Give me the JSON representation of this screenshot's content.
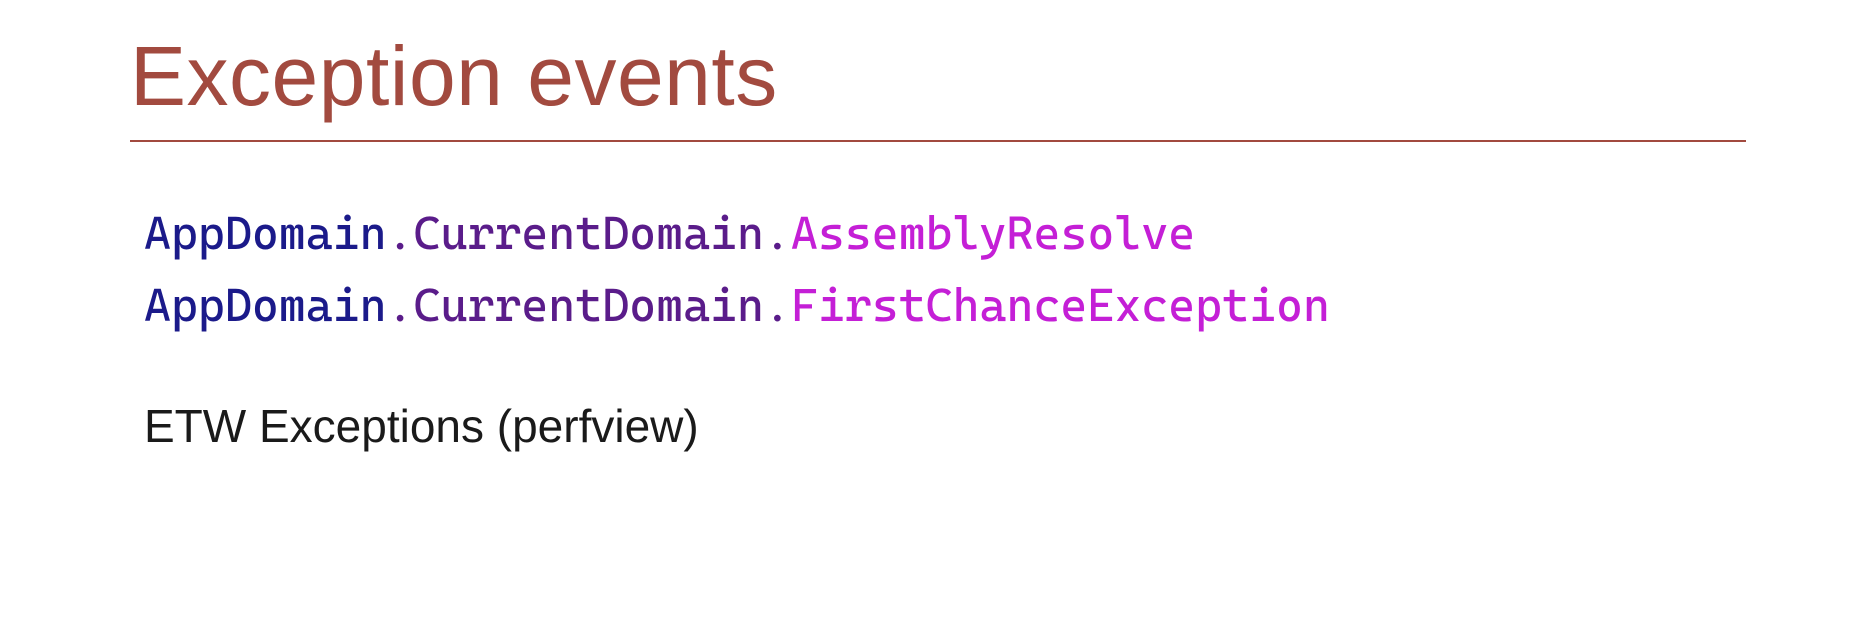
{
  "title": "Exception events",
  "colors": {
    "title": "#a24a3f",
    "rule": "#a24a3f",
    "code_type": "#1b1a8a",
    "code_member": "#5a1c8a",
    "code_event": "#c41fd6",
    "body": "#1a1a1a"
  },
  "code_lines": [
    {
      "type": "AppDomain",
      "member": "CurrentDomain",
      "event": "AssemblyResolve"
    },
    {
      "type": "AppDomain",
      "member": "CurrentDomain",
      "event": "FirstChanceException"
    }
  ],
  "body": "ETW Exceptions (perfview)"
}
